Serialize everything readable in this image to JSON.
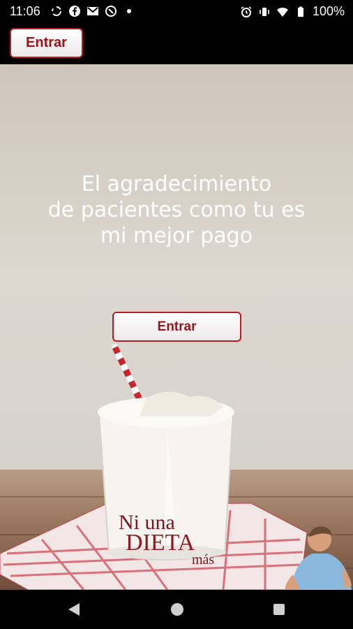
{
  "status_bar": {
    "time": "11:06",
    "battery": "100%",
    "left_icons": [
      "sync-icon",
      "facebook-icon",
      "gmail-icon",
      "data-saver-icon",
      "dot-icon"
    ],
    "right_icons": [
      "alarm-icon",
      "vibrate-icon",
      "wifi-icon",
      "battery-icon"
    ]
  },
  "header": {
    "enter_label": "Entrar"
  },
  "hero": {
    "headline": [
      "El agradecimiento",
      "de pacientes como tu es",
      "mi mejor pago"
    ],
    "enter_label": "Entrar",
    "glass_text": [
      "Ni una",
      "DIETA",
      "más"
    ]
  },
  "nav": {
    "icons": [
      "back-icon",
      "home-icon",
      "recents-icon"
    ]
  },
  "colors": {
    "accent": "#9c1219",
    "button_bg": "#f4f2f2",
    "bar_bg": "#000000"
  }
}
